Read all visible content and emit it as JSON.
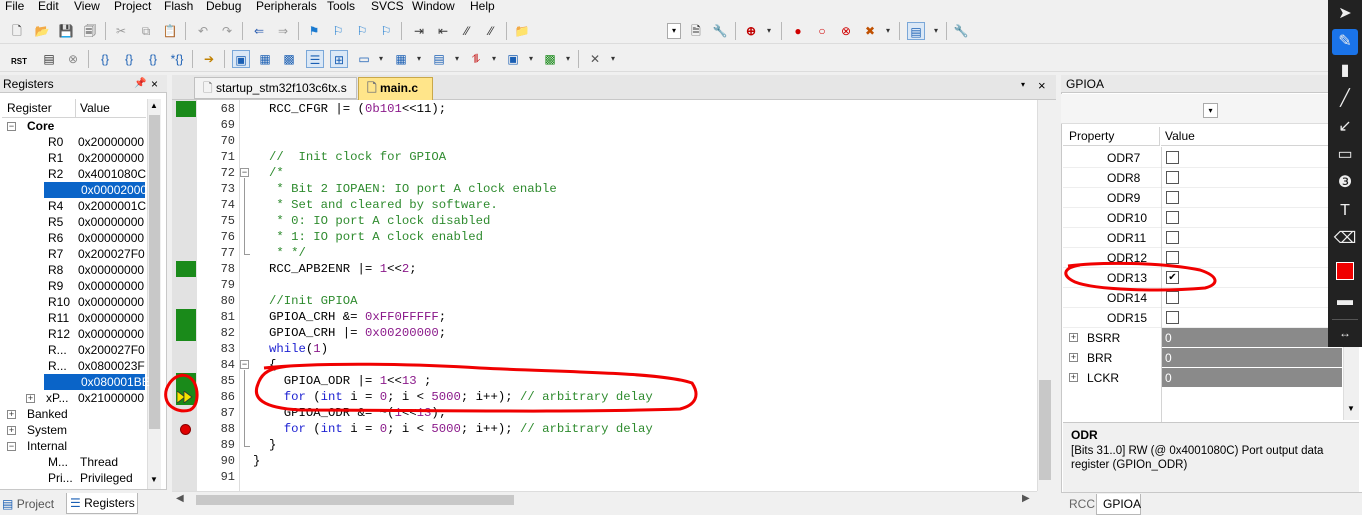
{
  "menu": [
    "File",
    "Edit",
    "View",
    "Project",
    "Flash",
    "Debug",
    "Peripherals",
    "Tools",
    "SVCS",
    "Window",
    "Help"
  ],
  "toolbar2": {
    "rst_label": "RST"
  },
  "registers": {
    "title": "Registers",
    "col_register": "Register",
    "col_value": "Value",
    "core_label": "Core",
    "rows": [
      {
        "name": "R0",
        "value": "0x20000000"
      },
      {
        "name": "R1",
        "value": "0x20000000"
      },
      {
        "name": "R2",
        "value": "0x4001080C"
      },
      {
        "name": "R3",
        "value": "0x00002000"
      },
      {
        "name": "R4",
        "value": "0x2000001C"
      },
      {
        "name": "R5",
        "value": "0x00000000"
      },
      {
        "name": "R6",
        "value": "0x00000000"
      },
      {
        "name": "R7",
        "value": "0x200027F0"
      },
      {
        "name": "R8",
        "value": "0x00000000"
      },
      {
        "name": "R9",
        "value": "0x00000000"
      },
      {
        "name": "R10",
        "value": "0x00000000"
      },
      {
        "name": "R11",
        "value": "0x00000000"
      },
      {
        "name": "R12",
        "value": "0x00000000"
      },
      {
        "name": "R...",
        "value": "0x200027F0"
      },
      {
        "name": "R...",
        "value": "0x0800023F"
      },
      {
        "name": "R...",
        "value": "0x080001BE"
      },
      {
        "name": "xP...",
        "value": "0x21000000"
      }
    ],
    "banked": "Banked",
    "system": "System",
    "internal": "Internal",
    "internal_rows": [
      {
        "name": "M...",
        "value": "Thread"
      },
      {
        "name": "Pri...",
        "value": "Privileged"
      }
    ],
    "tab_project": "Project",
    "tab_registers": "Registers"
  },
  "editor": {
    "tabs": [
      "startup_stm32f103c6tx.s",
      "main.c"
    ],
    "close_x": "×",
    "lines": [
      "68",
      "69",
      "70",
      "71",
      "72",
      "73",
      "74",
      "75",
      "76",
      "77",
      "78",
      "79",
      "80",
      "81",
      "82",
      "83",
      "84",
      "85",
      "86",
      "87",
      "88",
      "89",
      "90",
      "91"
    ],
    "code": {
      "l68a": "RCC_CFGR |= (",
      "l68b": "0b101",
      "l68c": "<<11);",
      "l71": "//  Init clock for GPIOA",
      "l72": "/*",
      "l73": " * Bit 2 IOPAEN: IO port A clock enable",
      "l74": " * Set and cleared by software.",
      "l75": " * 0: IO port A clock disabled",
      "l76": " * 1: IO port A clock enabled",
      "l77": " * */",
      "l78a": "RCC_APB2ENR |= ",
      "l78b": "1",
      "l78c": "<<",
      "l78d": "2",
      "l78e": ";",
      "l80": "//Init GPIOA",
      "l81a": "GPIOA_CRH &= ",
      "l81b": "0xFF0FFFFF",
      "l81c": ";",
      "l82a": "GPIOA_CRH |= ",
      "l82b": "0x00200000",
      "l82c": ";",
      "l83a": "while",
      "l83b": "(",
      "l83c": "1",
      "l83d": ")",
      "l84": "{",
      "l85a": "  GPIOA_ODR |= ",
      "l85b": "1",
      "l85c": "<<",
      "l85d": "13",
      "l85e": " ;",
      "l86a": "  for",
      "l86b": " (",
      "l86c": "int",
      "l86d": " i = ",
      "l86e": "0",
      "l86f": "; i < ",
      "l86g": "5000",
      "l86h": "; i++); ",
      "l86i": "// arbitrary delay",
      "l87a": "  GPIOA_ODR &= ~(",
      "l87b": "1",
      "l87c": "<<",
      "l87d": "13",
      "l87e": ");",
      "l88a": "  for",
      "l88b": " (",
      "l88c": "int",
      "l88d": " i = ",
      "l88e": "0",
      "l88f": "; i < ",
      "l88g": "5000",
      "l88h": "; i++); ",
      "l88i": "// arbitrary delay",
      "l89": "}",
      "l90": "}"
    }
  },
  "gpioa": {
    "title": "GPIOA",
    "close_x": "×",
    "col_property": "Property",
    "col_value": "Value",
    "fields": [
      {
        "name": "ODR7",
        "checked": false
      },
      {
        "name": "ODR8",
        "checked": false
      },
      {
        "name": "ODR9",
        "checked": false
      },
      {
        "name": "ODR10",
        "checked": false
      },
      {
        "name": "ODR11",
        "checked": false
      },
      {
        "name": "ODR12",
        "checked": false
      },
      {
        "name": "ODR13",
        "checked": true
      },
      {
        "name": "ODR14",
        "checked": false
      },
      {
        "name": "ODR15",
        "checked": false
      }
    ],
    "regs": [
      {
        "name": "BSRR",
        "value": "0"
      },
      {
        "name": "BRR",
        "value": "0"
      },
      {
        "name": "LCKR",
        "value": "0"
      }
    ],
    "desc_title": "ODR",
    "desc_body": "[Bits 31..0] RW (@ 0x4001080C) Port output data register  (GPIOn_ODR)",
    "tab_rcc": "RCC",
    "tab_gpioa": "GPIOA",
    "check_mark": "✔"
  },
  "colors": {
    "accent": "#0a64c8",
    "coverage": "#1a8a1a",
    "annotation": "#f00000",
    "breakpoint": "#e00000"
  }
}
